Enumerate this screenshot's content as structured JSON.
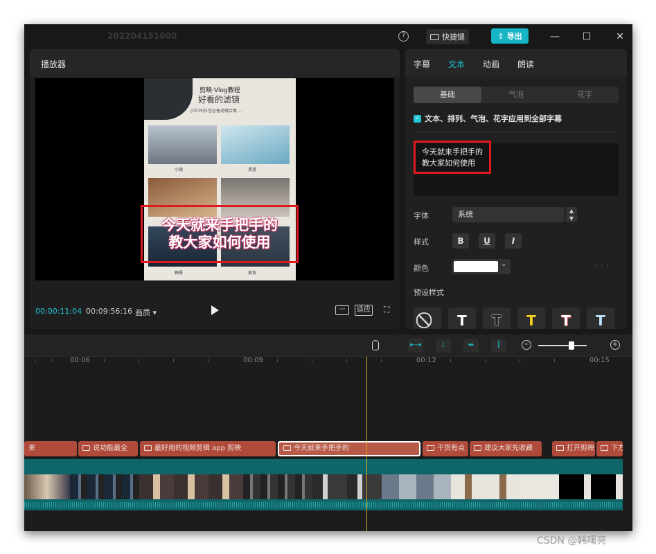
{
  "titlebar": {
    "project_title": "202204151000",
    "help": "?",
    "shortcut_label": "快捷键",
    "export_label": "导出",
    "minimize": "—",
    "maximize": "☐",
    "close": "✕"
  },
  "player": {
    "title": "播放器",
    "video_title": "剪映·Vlog教程",
    "video_subtitle": "好看的滤镜",
    "video_note": "小红书/抖音必备滤镜合集 ...",
    "captions": [
      "小镇",
      "清透",
      "野餐",
      "美食"
    ],
    "subtitle_line1": "今天就来手把手的",
    "subtitle_line2": "教大家如何使用",
    "current_time": "00:00:11:04",
    "duration": "00:09:56:16",
    "quality": "画质 ▾",
    "fit_label": "适应"
  },
  "inspector": {
    "tabs": [
      "字幕",
      "文本",
      "动画",
      "朗读"
    ],
    "active_tab": "文本",
    "segments": [
      "基础",
      "气泡",
      "花字"
    ],
    "apply_all": "文本、排列、气泡、花字应用到全部字幕",
    "text_value": "今天就来手把手的\n教大家如何使用",
    "font_label": "字体",
    "font_value": "系统",
    "style_label": "样式",
    "style_buttons": [
      "B",
      "U",
      "I"
    ],
    "color_label": "颜色",
    "color_value": "#ffffff",
    "preset_label": "预设样式",
    "presets": [
      "⃠",
      "T",
      "T",
      "T",
      "T",
      "T"
    ]
  },
  "timeline": {
    "ticks": [
      "00:06",
      "00:09",
      "00:12",
      "00:15"
    ],
    "text_clips": [
      "来",
      "说功能最全",
      "最好用的视频剪辑 app 剪映",
      "今天就来手把手的",
      "干货有点",
      "建议大家先收藏",
      "打开剪映",
      "下方"
    ],
    "selected_clip": "今天就来手把手的"
  },
  "watermark": "CSDN @韩曙亮",
  "colors": {
    "accent": "#20c6d6",
    "highlight_box": "#e0191f",
    "clip": "#b04a3a",
    "audio_track": "#0e6668",
    "playhead": "#d9a02a"
  }
}
